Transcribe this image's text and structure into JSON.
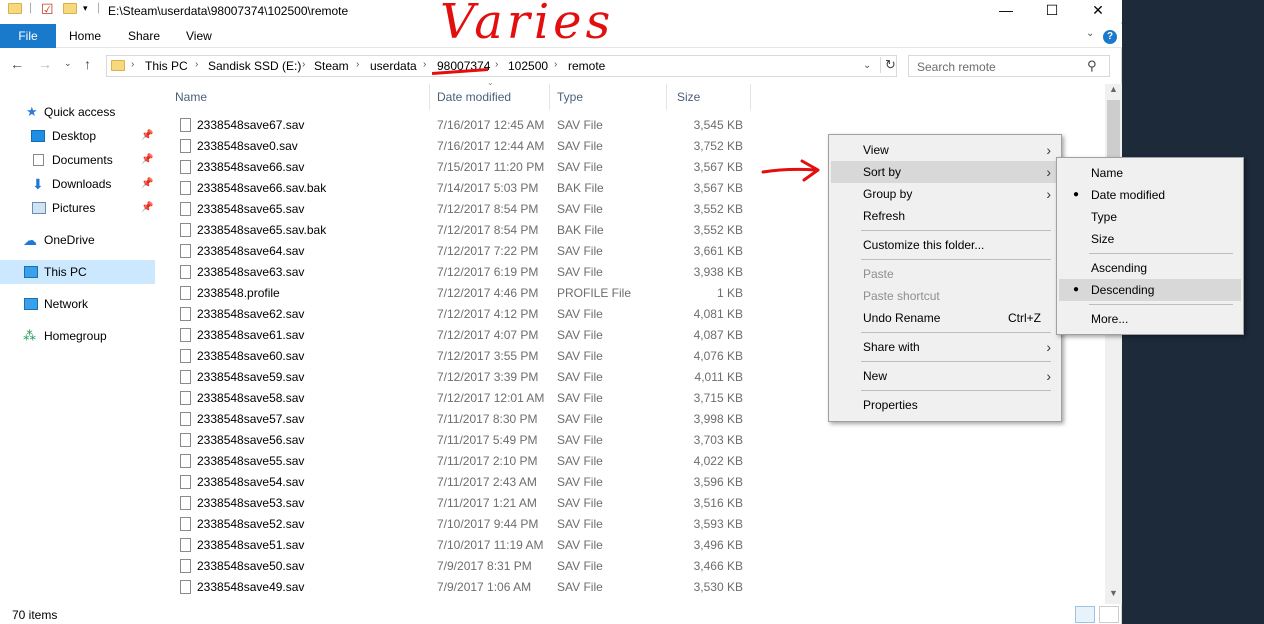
{
  "window": {
    "title": "E:\\Steam\\userdata\\98007374\\102500\\remote"
  },
  "ribbon": {
    "tabs": [
      "File",
      "Home",
      "Share",
      "View"
    ],
    "help": "?"
  },
  "address": {
    "crumbs": [
      "This PC",
      "Sandisk SSD (E:)",
      "Steam",
      "userdata",
      "98007374",
      "102500",
      "remote"
    ],
    "search_placeholder": "Search remote"
  },
  "nav": {
    "items": [
      {
        "label": "Quick access",
        "icon": "star-icon"
      },
      {
        "label": "Desktop",
        "icon": "desktop-icon",
        "pinned": true
      },
      {
        "label": "Documents",
        "icon": "documents-icon",
        "pinned": true
      },
      {
        "label": "Downloads",
        "icon": "download-icon",
        "pinned": true
      },
      {
        "label": "Pictures",
        "icon": "pictures-icon",
        "pinned": true
      },
      {
        "label": "OneDrive",
        "icon": "cloud-icon"
      },
      {
        "label": "This PC",
        "icon": "computer-icon",
        "selected": true
      },
      {
        "label": "Network",
        "icon": "network-icon"
      },
      {
        "label": "Homegroup",
        "icon": "homegroup-icon"
      }
    ]
  },
  "columns": {
    "name": "Name",
    "date": "Date modified",
    "type": "Type",
    "size": "Size"
  },
  "files": [
    {
      "name": "2338548save67.sav",
      "date": "7/16/2017 12:45 AM",
      "type": "SAV File",
      "size": "3,545 KB"
    },
    {
      "name": "2338548save0.sav",
      "date": "7/16/2017 12:44 AM",
      "type": "SAV File",
      "size": "3,752 KB"
    },
    {
      "name": "2338548save66.sav",
      "date": "7/15/2017 11:20 PM",
      "type": "SAV File",
      "size": "3,567 KB"
    },
    {
      "name": "2338548save66.sav.bak",
      "date": "7/14/2017 5:03 PM",
      "type": "BAK File",
      "size": "3,567 KB"
    },
    {
      "name": "2338548save65.sav",
      "date": "7/12/2017 8:54 PM",
      "type": "SAV File",
      "size": "3,552 KB"
    },
    {
      "name": "2338548save65.sav.bak",
      "date": "7/12/2017 8:54 PM",
      "type": "BAK File",
      "size": "3,552 KB"
    },
    {
      "name": "2338548save64.sav",
      "date": "7/12/2017 7:22 PM",
      "type": "SAV File",
      "size": "3,661 KB"
    },
    {
      "name": "2338548save63.sav",
      "date": "7/12/2017 6:19 PM",
      "type": "SAV File",
      "size": "3,938 KB"
    },
    {
      "name": "2338548.profile",
      "date": "7/12/2017 4:46 PM",
      "type": "PROFILE File",
      "size": "1 KB"
    },
    {
      "name": "2338548save62.sav",
      "date": "7/12/2017 4:12 PM",
      "type": "SAV File",
      "size": "4,081 KB"
    },
    {
      "name": "2338548save61.sav",
      "date": "7/12/2017 4:07 PM",
      "type": "SAV File",
      "size": "4,087 KB"
    },
    {
      "name": "2338548save60.sav",
      "date": "7/12/2017 3:55 PM",
      "type": "SAV File",
      "size": "4,076 KB"
    },
    {
      "name": "2338548save59.sav",
      "date": "7/12/2017 3:39 PM",
      "type": "SAV File",
      "size": "4,011 KB"
    },
    {
      "name": "2338548save58.sav",
      "date": "7/12/2017 12:01 AM",
      "type": "SAV File",
      "size": "3,715 KB"
    },
    {
      "name": "2338548save57.sav",
      "date": "7/11/2017 8:30 PM",
      "type": "SAV File",
      "size": "3,998 KB"
    },
    {
      "name": "2338548save56.sav",
      "date": "7/11/2017 5:49 PM",
      "type": "SAV File",
      "size": "3,703 KB"
    },
    {
      "name": "2338548save55.sav",
      "date": "7/11/2017 2:10 PM",
      "type": "SAV File",
      "size": "4,022 KB"
    },
    {
      "name": "2338548save54.sav",
      "date": "7/11/2017 2:43 AM",
      "type": "SAV File",
      "size": "3,596 KB"
    },
    {
      "name": "2338548save53.sav",
      "date": "7/11/2017 1:21 AM",
      "type": "SAV File",
      "size": "3,516 KB"
    },
    {
      "name": "2338548save52.sav",
      "date": "7/10/2017 9:44 PM",
      "type": "SAV File",
      "size": "3,593 KB"
    },
    {
      "name": "2338548save51.sav",
      "date": "7/10/2017 11:19 AM",
      "type": "SAV File",
      "size": "3,496 KB"
    },
    {
      "name": "2338548save50.sav",
      "date": "7/9/2017 8:31 PM",
      "type": "SAV File",
      "size": "3,466 KB"
    },
    {
      "name": "2338548save49.sav",
      "date": "7/9/2017 1:06 AM",
      "type": "SAV File",
      "size": "3,530 KB"
    }
  ],
  "status": {
    "items_count": "70 items"
  },
  "context_menu": {
    "view": "View",
    "sort_by": "Sort by",
    "group_by": "Group by",
    "refresh": "Refresh",
    "customize": "Customize this folder...",
    "paste": "Paste",
    "paste_shortcut": "Paste shortcut",
    "undo_rename": "Undo Rename",
    "undo_shortcut": "Ctrl+Z",
    "share_with": "Share with",
    "new": "New",
    "properties": "Properties"
  },
  "sort_submenu": {
    "name": "Name",
    "date_modified": "Date modified",
    "type": "Type",
    "size": "Size",
    "ascending": "Ascending",
    "descending": "Descending",
    "more": "More...",
    "selected_field": "Date modified",
    "selected_order": "Descending"
  },
  "annotation": {
    "text": "Varies",
    "color": "#e30e0e"
  },
  "colors": {
    "accent": "#1979ca",
    "selected_nav": "#cce8ff"
  }
}
